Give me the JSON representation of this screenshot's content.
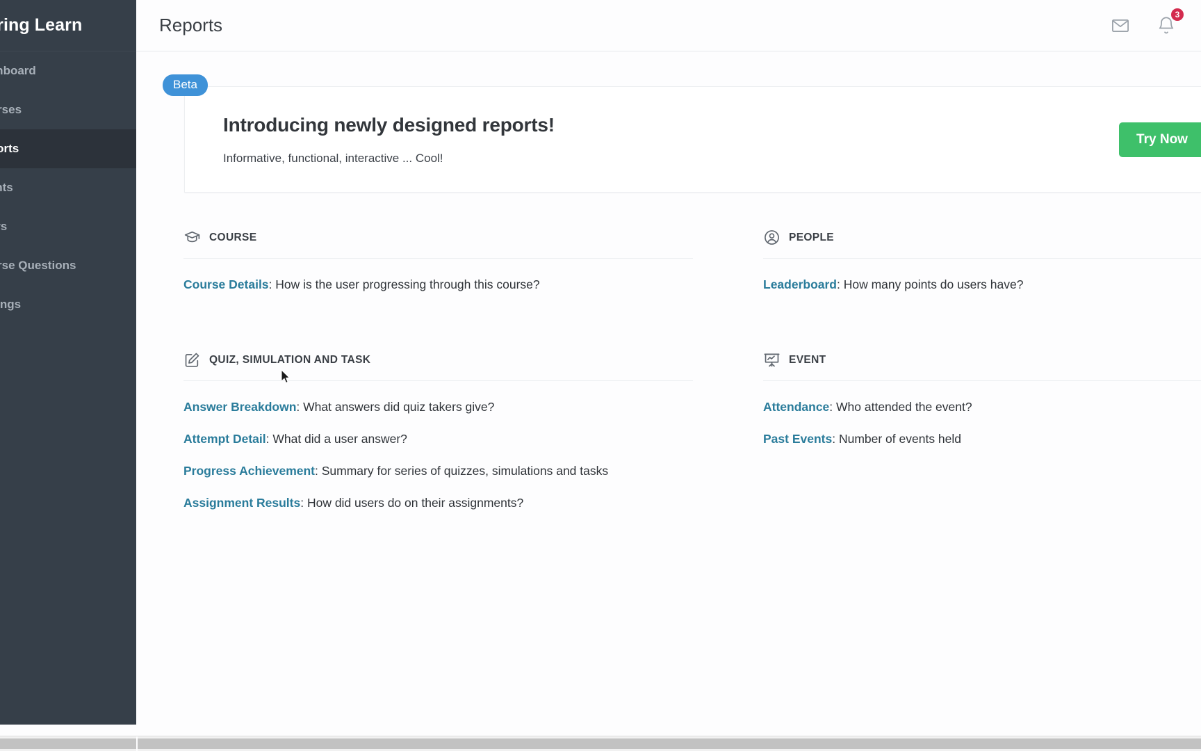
{
  "sidebar": {
    "brand": "Spring Learn",
    "items": [
      {
        "label": "Dashboard",
        "icon": "dashboard-icon",
        "active": false
      },
      {
        "label": "Courses",
        "icon": "courses-icon",
        "active": false
      },
      {
        "label": "Reports",
        "icon": "reports-icon",
        "active": true
      },
      {
        "label": "Events",
        "icon": "events-icon",
        "active": false
      },
      {
        "label": "Users",
        "icon": "users-icon",
        "active": false
      },
      {
        "label": "Course Questions",
        "icon": "question-icon",
        "active": false
      },
      {
        "label": "Settings",
        "icon": "gear-icon",
        "active": false
      }
    ]
  },
  "topbar": {
    "title": "Reports",
    "mail_icon": "mail-icon",
    "bell_icon": "bell-icon",
    "notification_count": "3"
  },
  "banner": {
    "badge": "Beta",
    "title": "Introducing newly designed reports!",
    "subtitle": "Informative, functional, interactive ... Cool!",
    "cta_label": "Try Now"
  },
  "sections": [
    {
      "key": "course",
      "icon": "graduation-cap-icon",
      "title": "COURSE",
      "reports": [
        {
          "link": "Course Details",
          "desc": ": How is the user progressing through this course?"
        }
      ]
    },
    {
      "key": "people",
      "icon": "user-circle-icon",
      "title": "PEOPLE",
      "reports": [
        {
          "link": "Leaderboard",
          "desc": ": How many points do users have?"
        }
      ]
    },
    {
      "key": "quiz",
      "icon": "edit-square-icon",
      "title": "QUIZ, SIMULATION AND TASK",
      "reports": [
        {
          "link": "Answer Breakdown",
          "desc": ": What answers did quiz takers give?"
        },
        {
          "link": "Attempt Detail",
          "desc": ": What did a user answer?"
        },
        {
          "link": "Progress Achievement",
          "desc": ": Summary for series of quizzes, simulations and tasks"
        },
        {
          "link": "Assignment Results",
          "desc": ": How did users do on their assignments?"
        }
      ]
    },
    {
      "key": "event",
      "icon": "presentation-chart-icon",
      "title": "EVENT",
      "reports": [
        {
          "link": "Attendance",
          "desc": ": Who attended the event?"
        },
        {
          "link": "Past Events",
          "desc": ": Number of events held"
        }
      ]
    }
  ],
  "colors": {
    "sidebar_bg": "#363f49",
    "sidebar_active_bg": "#2c323a",
    "accent_link": "#2a7c9b",
    "beta_badge": "#3f92d8",
    "cta_green": "#3ec06a",
    "badge_red": "#d32b4e"
  }
}
